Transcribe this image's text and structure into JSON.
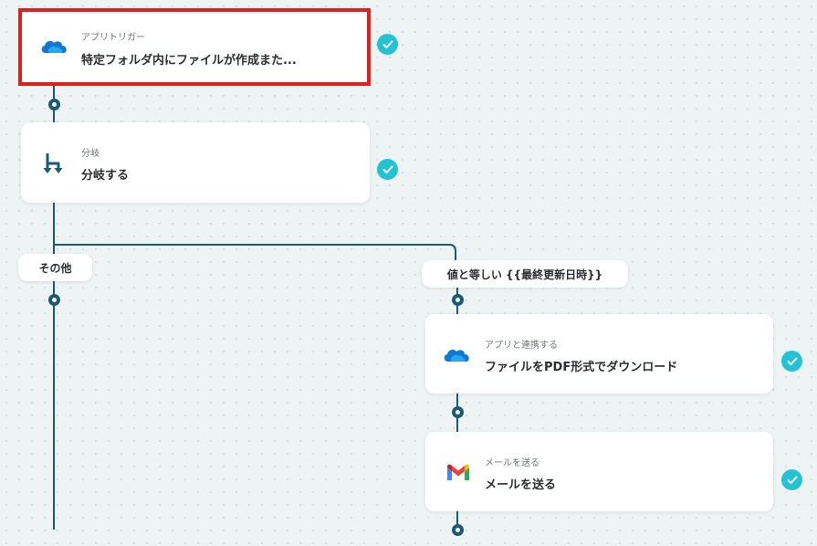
{
  "colors": {
    "connector": "#1b5a76",
    "check": "#23c3d3",
    "selection_border": "#e1201e",
    "onedrive_blue": "#0f78d4",
    "branch_icon": "#1b5a76"
  },
  "flow": {
    "trigger": {
      "subtitle": "アプリトリガー",
      "title": "特定フォルダ内にファイルが作成また...",
      "icon": "onedrive-icon",
      "status_icon": "check-icon",
      "selected": true
    },
    "branch": {
      "subtitle": "分岐",
      "title": "分岐する",
      "icon": "branch-icon",
      "status_icon": "check-icon"
    },
    "branch_labels": {
      "other": "その他",
      "condition": "値と等しい {{最終更新日時}}"
    },
    "action_onedrive": {
      "subtitle": "アプリと連携する",
      "title": "ファイルをPDF形式でダウンロード",
      "icon": "onedrive-icon",
      "status_icon": "check-icon"
    },
    "action_gmail": {
      "subtitle": "メールを送る",
      "title": "メールを送る",
      "icon": "gmail-icon",
      "status_icon": "check-icon"
    }
  }
}
